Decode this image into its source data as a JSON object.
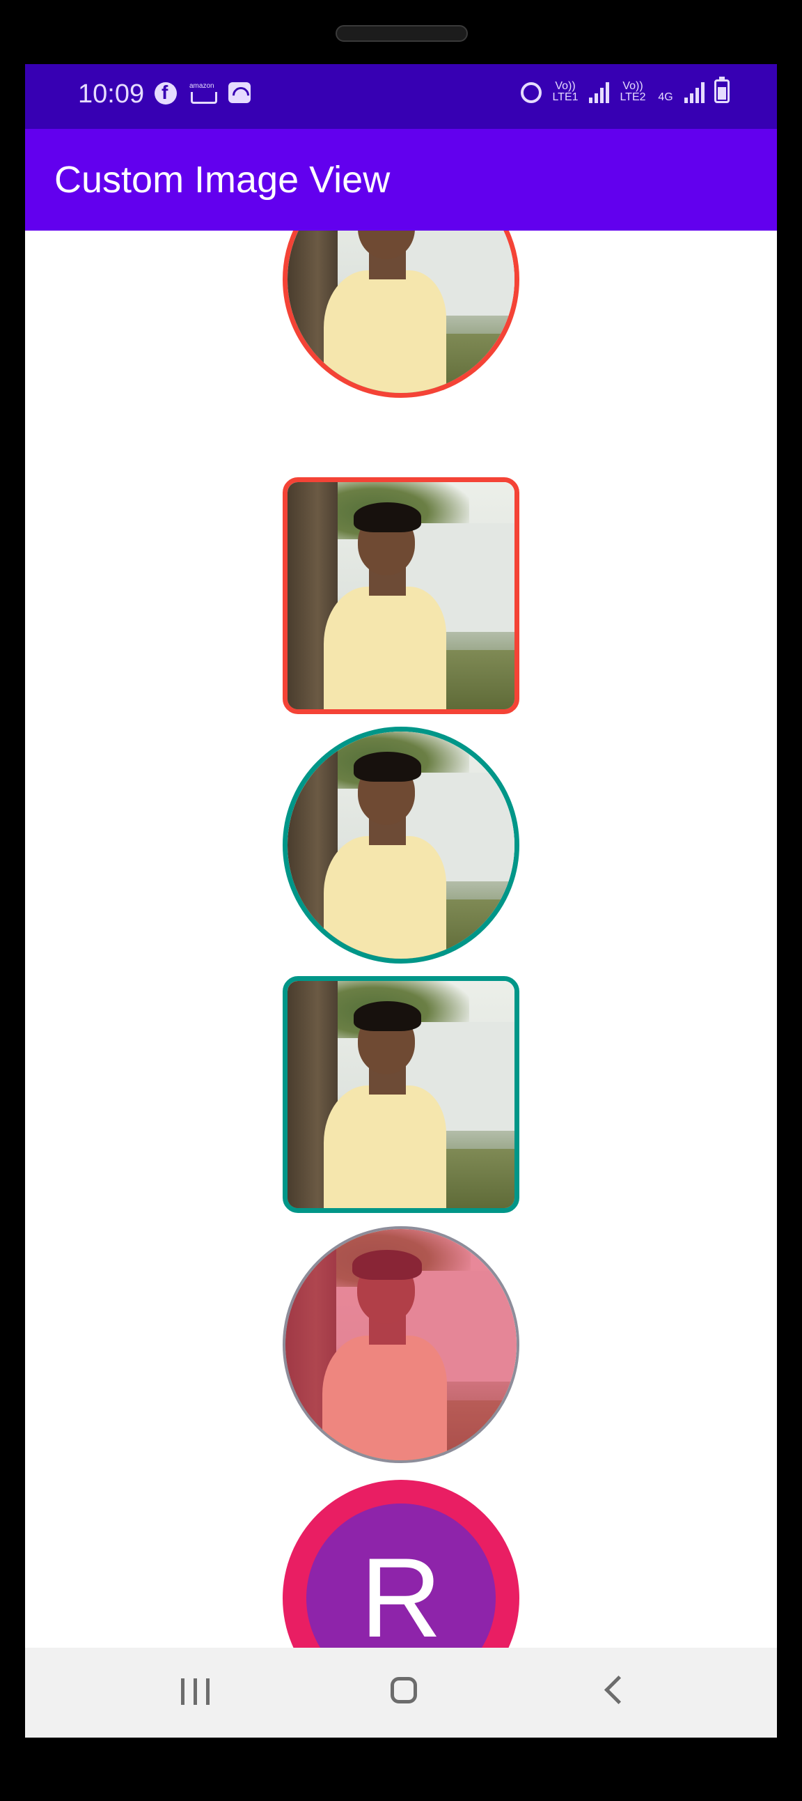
{
  "status_bar": {
    "time": "10:09",
    "left_icons": [
      "facebook-icon",
      "amazon-icon",
      "wifi-calling-icon"
    ],
    "right_icons": [
      "alarm-icon",
      "volte-lte1-icon",
      "signal-icon",
      "volte-lte2-icon",
      "network-4g-icon",
      "signal-icon",
      "battery-charging-icon"
    ],
    "volte1_label": "Vo)) LTE1",
    "volte2_label": "Vo)) LTE2",
    "network_label": "4G"
  },
  "app_bar": {
    "title": "Custom Image View",
    "color": "#6200ee",
    "status_color": "#3700b3"
  },
  "image_views": [
    {
      "shape": "circle",
      "border_color": "#f44336"
    },
    {
      "shape": "rounded-rect",
      "border_color": "#f44336"
    },
    {
      "shape": "circle",
      "border_color": "#009688"
    },
    {
      "shape": "rounded-rect",
      "border_color": "#009688"
    },
    {
      "shape": "circle",
      "border_color": "#8d8d9a",
      "tint": "#e8375a"
    }
  ],
  "monogram": {
    "letter": "R",
    "border_color": "#e91e63",
    "fill_color": "#8e24aa"
  },
  "nav_bar": {
    "buttons": [
      "recent-apps-icon",
      "home-icon",
      "back-icon"
    ]
  }
}
